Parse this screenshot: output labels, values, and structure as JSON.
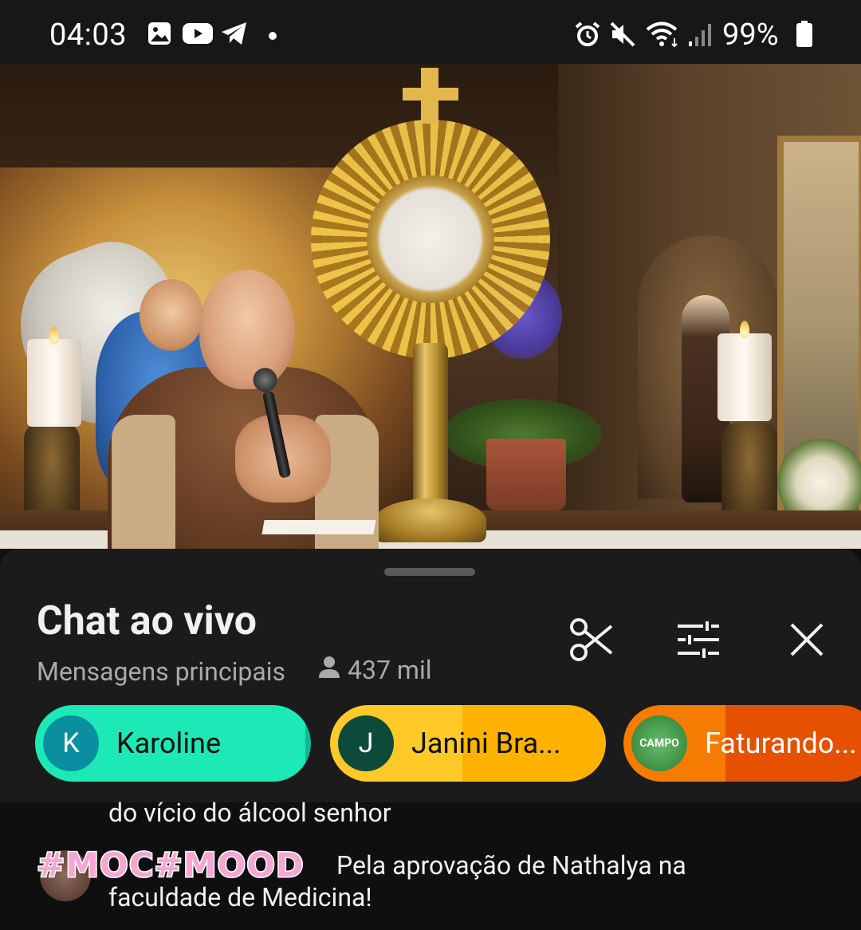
{
  "status_bar": {
    "time": "04:03",
    "battery": "99%",
    "left_icons": [
      "gallery-icon",
      "youtube-icon",
      "telegram-icon",
      "dot-icon"
    ],
    "right_icons": [
      "alarm-icon",
      "mute-icon",
      "wifi-icon",
      "signal-icon",
      "battery-icon"
    ]
  },
  "video": {
    "description_icon": "live-video-player"
  },
  "chat_panel": {
    "title": "Chat ao vivo",
    "subtitle": "Mensagens principais",
    "viewer_count": "437 mil",
    "actions": [
      "scissors-icon",
      "filter-sliders-icon",
      "close-icon"
    ]
  },
  "pinned_supporters": [
    {
      "initial": "K",
      "name": "Karoline",
      "bg": "#1de9b6",
      "avatar_bg": "#0a8fa0",
      "text_color": "#0f0f0f"
    },
    {
      "initial": "J",
      "name": "Janini Bra...",
      "bg": "#ffca28",
      "avatar_bg": "#0d4a3a",
      "text_color": "#0f0f0f"
    },
    {
      "initial": "",
      "name": "Faturando...",
      "avatar_text": "CAMPO",
      "bg": "#f57c00",
      "avatar_bg": "#4caf50",
      "text_color": "#ffffff"
    }
  ],
  "messages": [
    {
      "author": "",
      "text": "do vício do álcool senhor"
    },
    {
      "author": "#MOC#MOOD",
      "text_line1": "Pela aprovação de Nathalya na",
      "text_line2": "faculdade de Medicina!"
    }
  ],
  "colors": {
    "sheet_bg": "#1b1b1b",
    "page_bg": "#0f0f0f",
    "secondary_text": "#aaaaaa"
  }
}
